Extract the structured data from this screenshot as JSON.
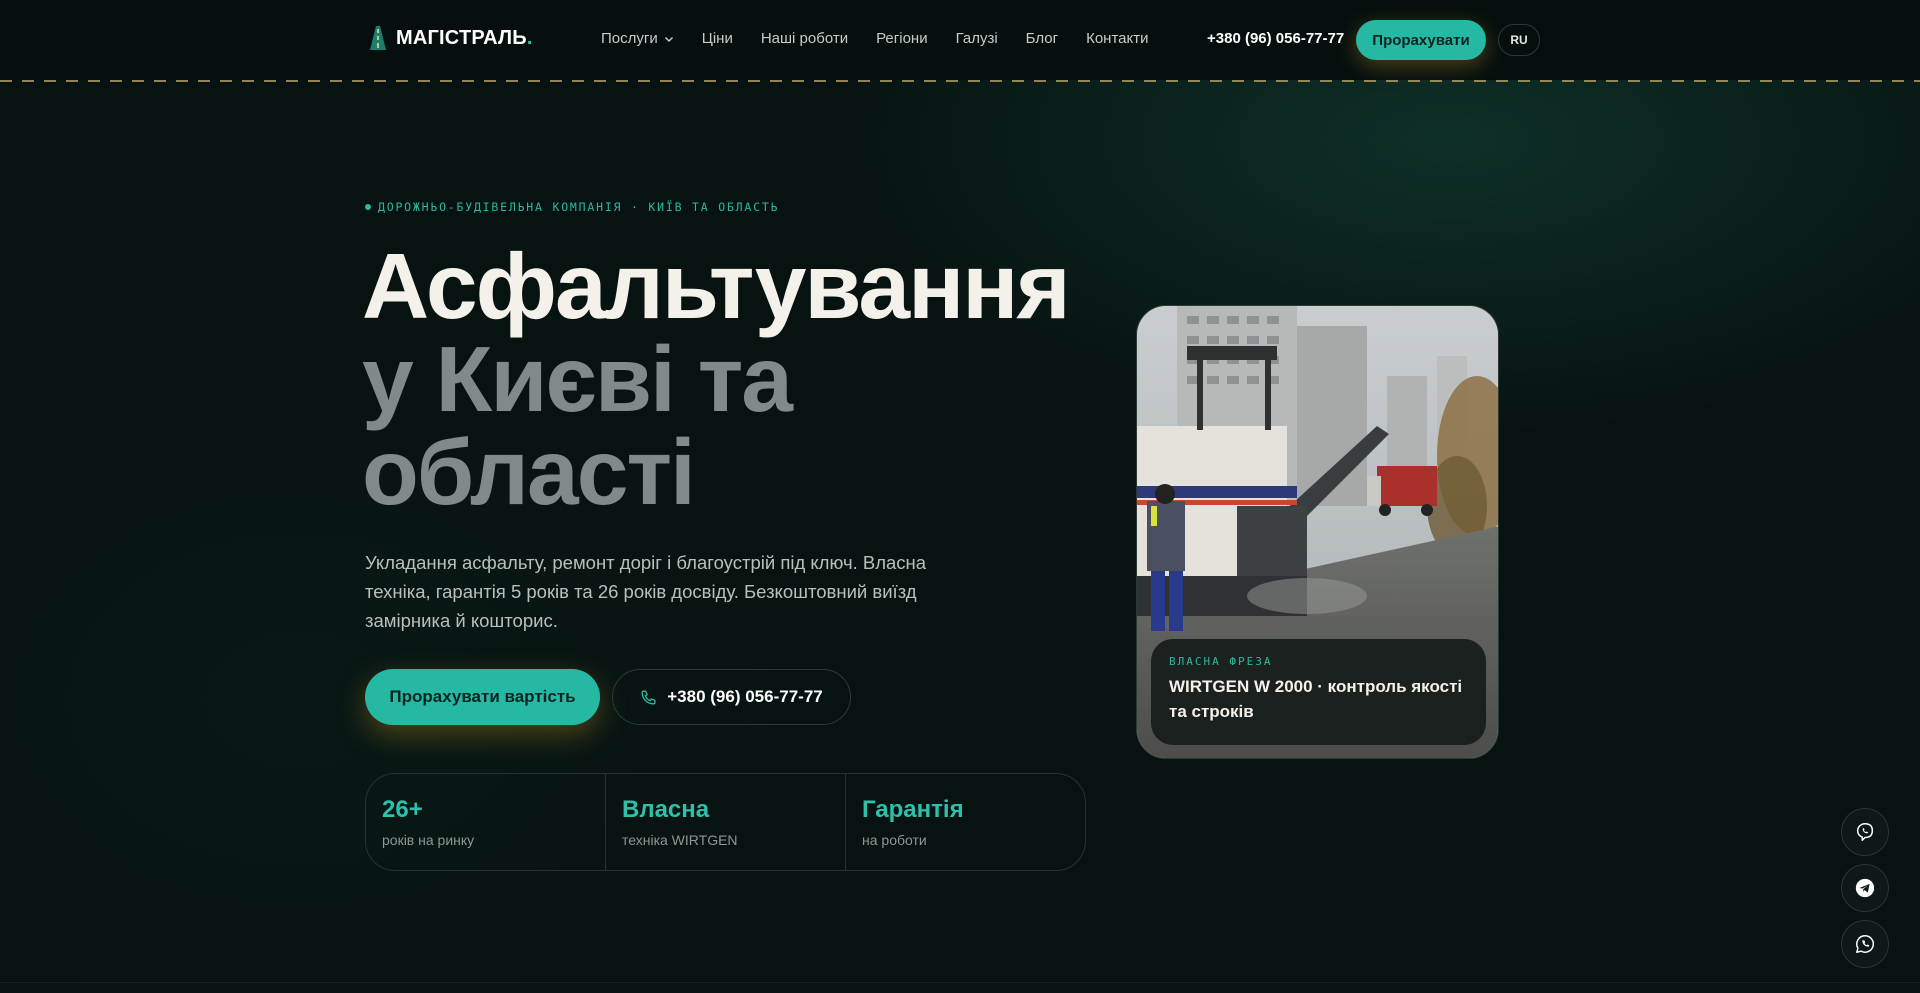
{
  "brand": {
    "name": "МАГІСТРАЛЬ",
    "name_suffix": ".",
    "accent": "#25b9a4"
  },
  "nav": {
    "items": [
      "Послуги",
      "Ціни",
      "Наші роботи",
      "Регіони",
      "Галузі",
      "Блог",
      "Контакти"
    ]
  },
  "header": {
    "phone": "+380 (96) 056-77-77",
    "cta_label": "Прорахувати",
    "lang_label": "RU"
  },
  "hero": {
    "eyebrow": "ДОРОЖНЬО-БУДІВЕЛЬНА КОМПАНІЯ · КИЇВ ТА ОБЛАСТЬ",
    "title_line1": "Асфальтування",
    "title_line2": "у Києві та",
    "title_line3": "області",
    "lead": "Укладання асфальту, ремонт доріг і благоустрій під ключ. Власна техніка, гарантія 5 років та 26 років досвіду. Безкоштовний виїзд замірника й кошторис.",
    "cta_primary": "Прорахувати вартість",
    "cta_phone": "+380 (96) 056-77-77"
  },
  "stats": [
    {
      "value": "26+",
      "label": "років на ринку"
    },
    {
      "value": "Власна",
      "label": "техніка WIRTGEN"
    },
    {
      "value": "Гарантія",
      "label": "на роботи"
    }
  ],
  "photo_card": {
    "eyebrow": "ВЛАСНА ФРЕЗА",
    "caption": "WIRTGEN W 2000 · контроль якості та строків"
  },
  "socials": [
    "viber-icon",
    "telegram-icon",
    "whatsapp-icon"
  ]
}
